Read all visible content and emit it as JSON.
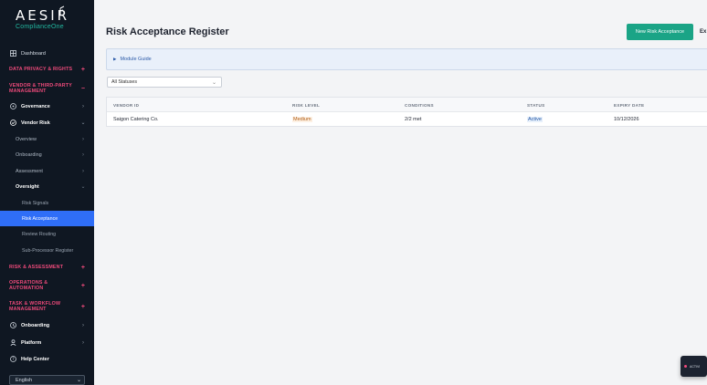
{
  "brand": {
    "name": "AESIR",
    "subtitle": "ComplianceOne"
  },
  "sidebar": {
    "dashboard": "Dashboard",
    "section_data_privacy": "DATA PRIVACY & RIGHTS",
    "section_vendor": "VENDOR & THIRD-PARTY MANAGEMENT",
    "governance": "Governance",
    "vendor_risk": "Vendor Risk",
    "overview": "Overview",
    "onboarding_sub": "Onboarding",
    "assessment": "Assessment",
    "oversight": "Oversight",
    "risk_signals": "Risk Signals",
    "risk_acceptance": "Risk Acceptance",
    "review_routing": "Review Routing",
    "sub_processor": "Sub-Processor Register",
    "section_risk": "RISK & ASSESSMENT",
    "section_operations": "OPERATIONS & AUTOMATION",
    "section_task": "TASK & WORKFLOW MANAGEMENT",
    "onboarding": "Onboarding",
    "platform": "Platform",
    "help_center": "Help Center",
    "language": "English"
  },
  "page": {
    "title": "Risk Acceptance Register",
    "new_button": "New Risk Acceptance",
    "export_button": "Ex",
    "module_guide": "Module Guide",
    "filter_value": "All Statuses"
  },
  "table": {
    "headers": [
      "VENDOR ID",
      "RISK LEVEL",
      "CONDITIONS",
      "STATUS",
      "EXPIRY DATE"
    ],
    "rows": [
      {
        "vendor": "Saigon Catering Co.",
        "risk_level": "Medium",
        "conditions": "2/2 met",
        "status": "Active",
        "expiry": "10/12/2026"
      }
    ]
  },
  "toast": {
    "text": "ACTIVI"
  },
  "colors": {
    "sidebar_bg": "#0f1722",
    "accent_pink": "#ef4a7b",
    "active_blue": "#2f6ef7",
    "primary_green": "#1aa486"
  }
}
